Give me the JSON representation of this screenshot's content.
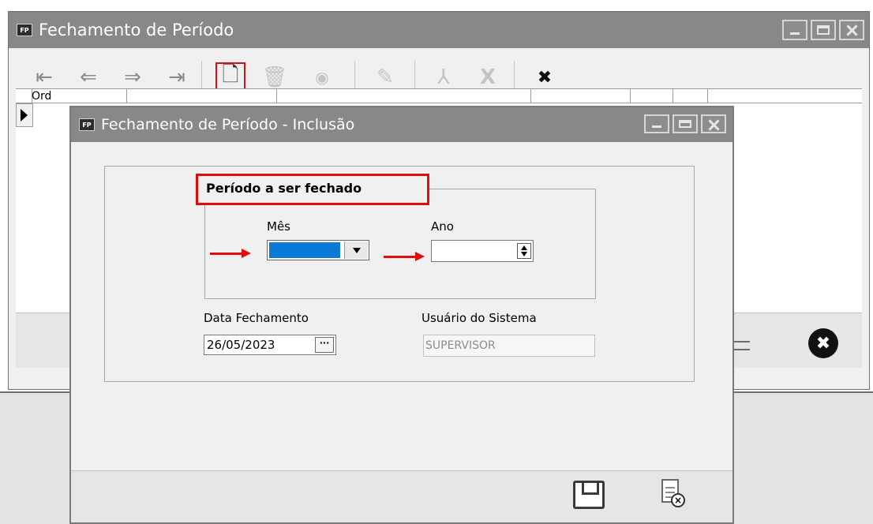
{
  "main_window": {
    "badge": "FP",
    "title": "Fechamento de Período",
    "grid_header_first": "Ord"
  },
  "dialog": {
    "badge": "FP",
    "title": "Fechamento de Período  - Inclusão",
    "group_label": "Período a ser fechado",
    "mes_label": "Mês",
    "mes_value": "",
    "ano_label": "Ano",
    "ano_value": "",
    "data_label": "Data Fechamento",
    "data_value": "26/05/2023",
    "data_button": "···",
    "usuario_label": "Usuário do Sistema",
    "usuario_value": "SUPERVISOR"
  },
  "toolbar": {
    "first_icon": "⇤",
    "prev_icon": "⇐",
    "next_icon": "⇒",
    "last_icon": "⇥",
    "new_icon": "🗋",
    "delete_icon": "🗑",
    "view_icon": "◉",
    "edit_icon": "✎",
    "pdf_icon": "⅄",
    "excel_icon": "X",
    "close_icon": "✖"
  },
  "colors": {
    "highlight_red": "#e20a0a",
    "selection_blue": "#0a7ad6",
    "titlebar_gray": "#888888"
  }
}
